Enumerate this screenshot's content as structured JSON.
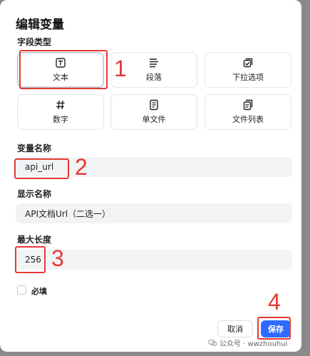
{
  "dialog": {
    "title": "编辑变量",
    "field_type_label": "字段类型",
    "types": [
      {
        "label": "文本",
        "icon": "text-box-icon"
      },
      {
        "label": "段落",
        "icon": "paragraph-icon"
      },
      {
        "label": "下拉选项",
        "icon": "dropdown-option-icon"
      },
      {
        "label": "数字",
        "icon": "hash-icon"
      },
      {
        "label": "单文件",
        "icon": "file-icon"
      },
      {
        "label": "文件列表",
        "icon": "file-list-icon"
      }
    ],
    "var_name_label": "变量名称",
    "var_name_value": "api_url",
    "display_name_label": "显示名称",
    "display_name_value": "API文档Url（二选一）",
    "max_length_label": "最大长度",
    "max_length_value": "256",
    "required_label": "必填",
    "cancel_label": "取消",
    "save_label": "保存"
  },
  "annotations": [
    "1",
    "2",
    "3",
    "4"
  ],
  "watermark": "公众号 · wwzhouhui",
  "colors": {
    "accent": "#2f6bff",
    "annotation": "#e53935"
  }
}
